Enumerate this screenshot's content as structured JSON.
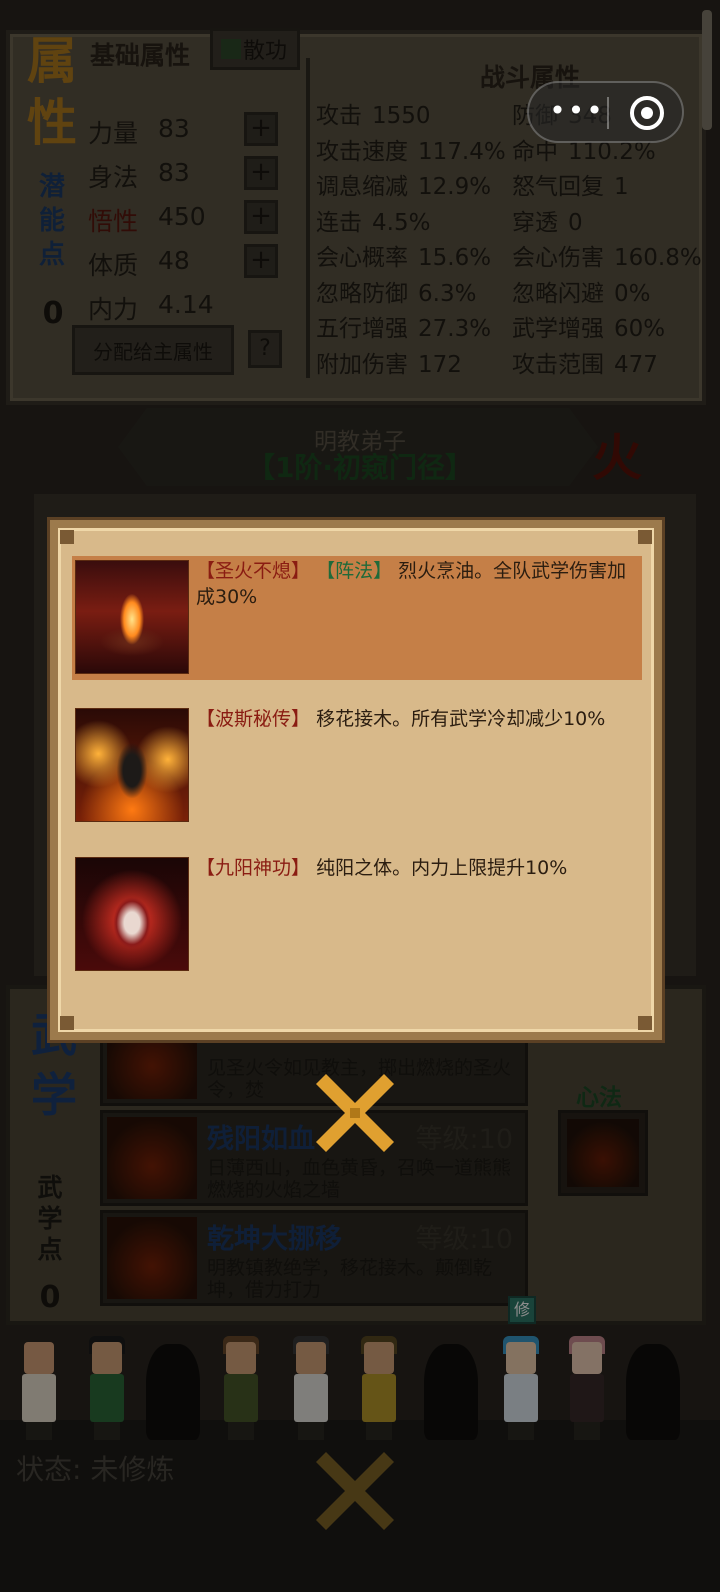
{
  "attributes": {
    "title": "属性",
    "basic_title": "基础属性",
    "dispel_label": "散功",
    "potential_label": "潜能点",
    "potential_value": "0",
    "stats": [
      {
        "label": "力量",
        "value": "83"
      },
      {
        "label": "身法",
        "value": "83"
      },
      {
        "label": "悟性",
        "value": "450"
      },
      {
        "label": "体质",
        "value": "48"
      },
      {
        "label": "内力",
        "value": "4.14"
      }
    ],
    "plus_label": "+",
    "assign_label": "分配给主属性",
    "help_label": "?"
  },
  "battle": {
    "title": "战斗属性",
    "stats": [
      {
        "label": "攻击",
        "value": "1550"
      },
      {
        "label": "防御",
        "value": "348"
      },
      {
        "label": "攻击速度",
        "value": "117.4%"
      },
      {
        "label": "命中",
        "value": "110.2%"
      },
      {
        "label": "调息缩减",
        "value": "12.9%"
      },
      {
        "label": "怒气回复",
        "value": "1"
      },
      {
        "label": "连击",
        "value": "4.5%"
      },
      {
        "label": "穿透",
        "value": "0"
      },
      {
        "label": "会心概率",
        "value": "15.6%"
      },
      {
        "label": "会心伤害",
        "value": "160.8%"
      },
      {
        "label": "忽略防御",
        "value": "6.3%"
      },
      {
        "label": "忽略闪避",
        "value": "0%"
      },
      {
        "label": "五行增强",
        "value": "27.3%"
      },
      {
        "label": "武学增强",
        "value": "60%"
      },
      {
        "label": "附加伤害",
        "value": "172"
      },
      {
        "label": "攻击范围",
        "value": "477"
      }
    ]
  },
  "sect": {
    "name": "明教弟子",
    "rank": "【1阶·初窥门径】",
    "element": "火"
  },
  "martial": {
    "title": "武学",
    "points_label": "武学点",
    "points_value": "0",
    "heart_label": "心法",
    "skills": [
      {
        "name": "",
        "level": "",
        "desc": "见圣火令如见教主，掷出燃烧的圣火令，焚"
      },
      {
        "name": "残阳如血",
        "level": "等级:10",
        "desc": "日薄西山，血色黄昏，召唤一道熊熊燃烧的火焰之墙"
      },
      {
        "name": "乾坤大挪移",
        "level": "等级:10",
        "desc": "明教镇教绝学，移花接木。颠倒乾坤，借力打力"
      }
    ]
  },
  "status": {
    "text": "状态: 未修炼",
    "badge": "修"
  },
  "modal": {
    "traits": [
      {
        "name": "【圣火不熄】",
        "tag": "【阵法】",
        "desc": "烈火烹油。全队武学伤害加成30%",
        "highlighted": true
      },
      {
        "name": "【波斯秘传】",
        "tag": "",
        "desc": "移花接木。所有武学冷却减少10%",
        "highlighted": false
      },
      {
        "name": "【九阳神功】",
        "tag": "",
        "desc": "纯阳之体。内力上限提升10%",
        "highlighted": false
      }
    ]
  },
  "capsule": {
    "more": "•••"
  },
  "icons": {
    "close": "close-x-icon",
    "more": "more-dots-icon",
    "target": "target-icon",
    "play": "play-icon"
  },
  "colors": {
    "modal_bg": "#d8b98a",
    "highlight": "#c57f47",
    "trait_name": "#8a1c12",
    "trait_tag": "#1f6a3a",
    "close_x": "#e0a030"
  }
}
